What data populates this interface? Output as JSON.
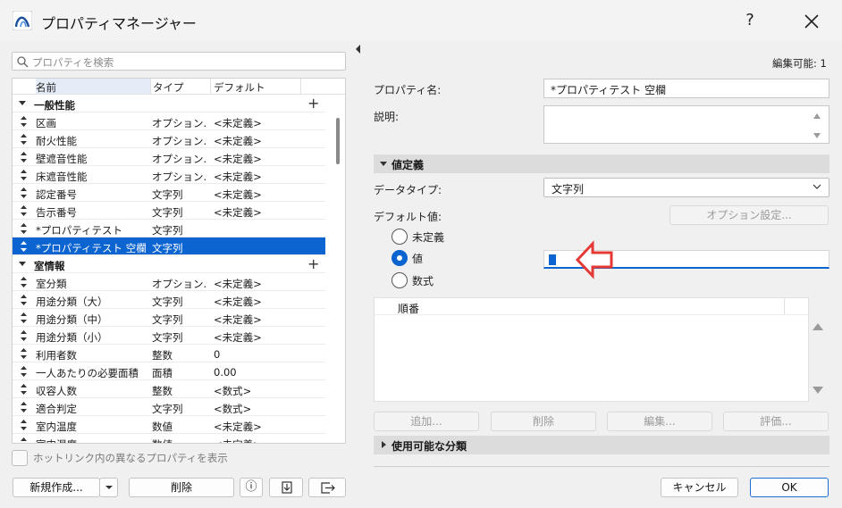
{
  "window": {
    "title": "プロパティマネージャー",
    "help_label": "?"
  },
  "search": {
    "placeholder": "プロパティを検索"
  },
  "list": {
    "columns": {
      "name": "名前",
      "type": "タイプ",
      "default": "デフォルト"
    },
    "groups": [
      {
        "label": "一般性能",
        "items": [
          {
            "name": "区画",
            "type": "オプション...",
            "default": "<未定義>"
          },
          {
            "name": "耐火性能",
            "type": "オプション...",
            "default": "<未定義>"
          },
          {
            "name": "壁遮音性能",
            "type": "オプション...",
            "default": "<未定義>"
          },
          {
            "name": "床遮音性能",
            "type": "オプション...",
            "default": "<未定義>"
          },
          {
            "name": "認定番号",
            "type": "文字列",
            "default": "<未定義>"
          },
          {
            "name": "告示番号",
            "type": "文字列",
            "default": "<未定義>"
          },
          {
            "name": "*プロパティテスト",
            "type": "文字列",
            "default": ""
          },
          {
            "name": "*プロパティテスト 空欄",
            "type": "文字列",
            "default": "",
            "selected": true
          }
        ]
      },
      {
        "label": "室情報",
        "items": [
          {
            "name": "室分類",
            "type": "オプション...",
            "default": "<未定義>"
          },
          {
            "name": "用途分類（大）",
            "type": "文字列",
            "default": "<未定義>"
          },
          {
            "name": "用途分類（中）",
            "type": "文字列",
            "default": "<未定義>"
          },
          {
            "name": "用途分類（小）",
            "type": "文字列",
            "default": "<未定義>"
          },
          {
            "name": "利用者数",
            "type": "整数",
            "default": "0"
          },
          {
            "name": "一人あたりの必要面積",
            "type": "面積",
            "default": "0.00"
          },
          {
            "name": "収容人数",
            "type": "整数",
            "default": "<数式>"
          },
          {
            "name": "適合判定",
            "type": "文字列",
            "default": "<数式>"
          },
          {
            "name": "室内温度",
            "type": "数値",
            "default": "<未定義>"
          },
          {
            "name": "室内湿度",
            "type": "数値",
            "default": "<未定義>"
          }
        ]
      }
    ]
  },
  "hotlink_checkbox": {
    "label": "ホットリンク内の異なるプロパティを表示",
    "checked": false
  },
  "left_buttons": {
    "new": "新規作成...",
    "delete": "削除",
    "info": "ⓘ"
  },
  "right": {
    "editable": "編集可能: 1",
    "property_name_label": "プロパティ名:",
    "property_name_value": "*プロパティテスト 空欄",
    "description_label": "説明:",
    "value_def_section": "値定義",
    "data_type_label": "データタイプ:",
    "data_type_value": "文字列",
    "default_value_label": "デフォルト値:",
    "option_settings": "オプション設定...",
    "radio_undefined": "未定義",
    "radio_value": "値",
    "radio_formula": "数式",
    "order_header": "順番",
    "add_btn": "追加...",
    "delete_btn": "削除",
    "edit_btn": "編集...",
    "eval_btn": "評価...",
    "classification_section": "使用可能な分類",
    "cancel_btn": "キャンセル",
    "ok_btn": "OK"
  },
  "colors": {
    "accent": "#0b64d0",
    "arrow": "#e53935"
  }
}
